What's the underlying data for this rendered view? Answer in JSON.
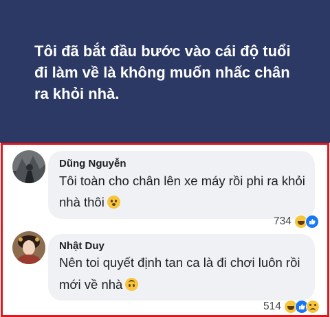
{
  "post": {
    "text_lines": [
      "Tôi đã bắt đầu bước vào cái độ tuổi",
      "đi làm về là không muốn nhấc chân",
      "ra khỏi nhà."
    ],
    "background_color": "#2b3964"
  },
  "comments": [
    {
      "author": "Dũng Nguyễn",
      "lines": [
        "Tôi toàn cho chân lên xe máy rồi phi ra khỏi",
        "nhà thôi"
      ],
      "emoji": "kissing-face-icon",
      "reaction_count": "734",
      "reactions": [
        "haha-reaction-icon",
        "like-reaction-icon"
      ]
    },
    {
      "author": "Nhật Duy",
      "lines": [
        "Nên toi quyết định tan ca là đi chơi luôn rồi",
        "mới về nhà"
      ],
      "emoji": "upside-down-face-icon",
      "reaction_count": "514",
      "reactions": [
        "haha-reaction-icon",
        "like-reaction-icon",
        "sad-reaction-icon"
      ]
    }
  ],
  "highlight_color": "#e6141b"
}
